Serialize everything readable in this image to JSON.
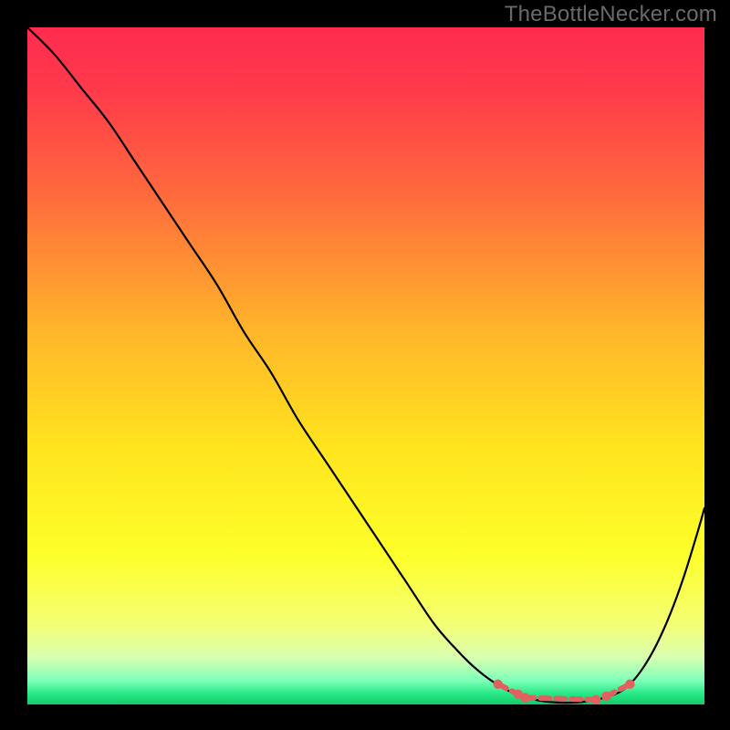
{
  "watermark": "TheBottleNecker.com",
  "chart_data": {
    "type": "line",
    "title": "",
    "xlabel": "",
    "ylabel": "",
    "xlim": [
      0,
      100
    ],
    "ylim": [
      0,
      100
    ],
    "grid": false,
    "background_gradient": [
      {
        "offset": 0.0,
        "color": "#ff2b4f"
      },
      {
        "offset": 0.1,
        "color": "#ff3c4a"
      },
      {
        "offset": 0.25,
        "color": "#ff6b3d"
      },
      {
        "offset": 0.45,
        "color": "#ffb62a"
      },
      {
        "offset": 0.62,
        "color": "#ffe41e"
      },
      {
        "offset": 0.78,
        "color": "#fdff2a"
      },
      {
        "offset": 0.88,
        "color": "#f4ff73"
      },
      {
        "offset": 0.93,
        "color": "#d9ffb0"
      },
      {
        "offset": 0.965,
        "color": "#7dffb9"
      },
      {
        "offset": 0.985,
        "color": "#23e884"
      },
      {
        "offset": 1.0,
        "color": "#17c86d"
      }
    ],
    "series": [
      {
        "name": "curve",
        "stroke": "#000000",
        "stroke_width": 2.2,
        "x": [
          0,
          4,
          8,
          12,
          16,
          20,
          24,
          28,
          32,
          36,
          40,
          44,
          48,
          52,
          56,
          60,
          63,
          66,
          69,
          72,
          75,
          78,
          81,
          84,
          87,
          89,
          91,
          93,
          95,
          97,
          99,
          100
        ],
        "y": [
          100,
          96,
          91,
          86,
          80,
          74,
          68,
          62,
          55,
          49,
          42,
          36,
          30,
          24,
          18,
          12,
          8.5,
          5.5,
          3.2,
          1.6,
          0.7,
          0.3,
          0.3,
          0.7,
          1.6,
          3.0,
          5.5,
          9.0,
          13.5,
          19.0,
          25.5,
          29.0
        ]
      }
    ],
    "highlight": {
      "stroke": "#e16060",
      "stroke_width": 6.0,
      "dash": [
        10,
        7
      ],
      "cap_radius": 5.2,
      "segments": [
        {
          "x0": 69.5,
          "y0": 3.0,
          "x1": 72.5,
          "y1": 1.5
        },
        {
          "x0": 73.5,
          "y0": 1.0,
          "x1": 84.0,
          "y1": 0.7
        },
        {
          "x0": 85.5,
          "y0": 1.2,
          "x1": 89.0,
          "y1": 3.0
        }
      ]
    }
  }
}
